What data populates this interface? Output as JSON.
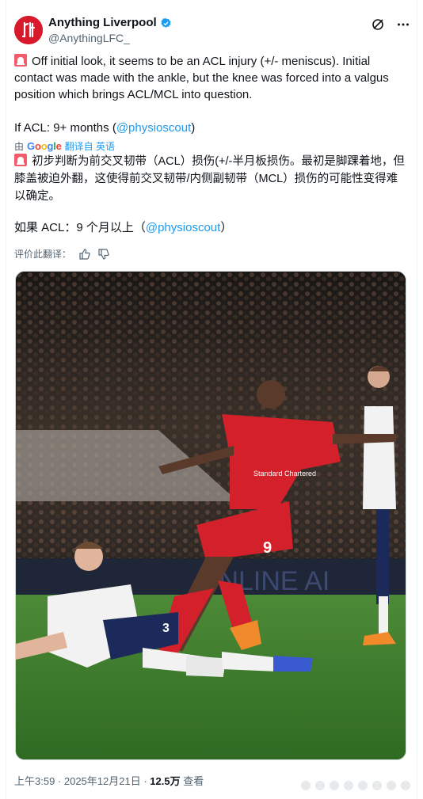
{
  "author": {
    "display_name": "Anything Liverpool",
    "handle": "@AnythingLFC_",
    "avatar_letters": "LFC",
    "brand_color": "#d7192b"
  },
  "post": {
    "original_p1": "Off initial look, it seems to be an ACL injury (+/- meniscus). Initial contact was made with the ankle, but the knee was forced into a valgus position which brings ACL/MCL into question.",
    "original_p2_prefix": "If ACL: 9+ months (",
    "original_p2_mention": "@physioscout",
    "original_p2_suffix": ")",
    "translate_by": "由",
    "translate_link": "翻译自 英语",
    "translated_p1": "初步判断为前交叉韧带（ACL）损伤(+/-半月板损伤。最初是脚踝着地，但膝盖被迫外翻，这使得前交叉韧带/内侧副韧带（MCL）损伤的可能性变得难以确定。",
    "translated_p2_prefix": "如果 ACL：9 个月以上（",
    "translated_p2_mention": "@physioscout",
    "translated_p2_suffix": "）",
    "rate_label": "评价此翻译：",
    "photo_sponsor_text": "Standard Chartered",
    "photo_shirt_number": "9",
    "photo_ad_text": "ONLINE AI",
    "photo_opponent_number": "3"
  },
  "footer": {
    "time": "上午3:59",
    "separator": " · ",
    "date": "2025年12月21日",
    "views_count": "12.5万",
    "views_label": "查看"
  },
  "colors": {
    "link": "#1d9bf0",
    "muted": "#536471",
    "pitch": "#3f7a2c",
    "kit_red": "#d3202b"
  }
}
